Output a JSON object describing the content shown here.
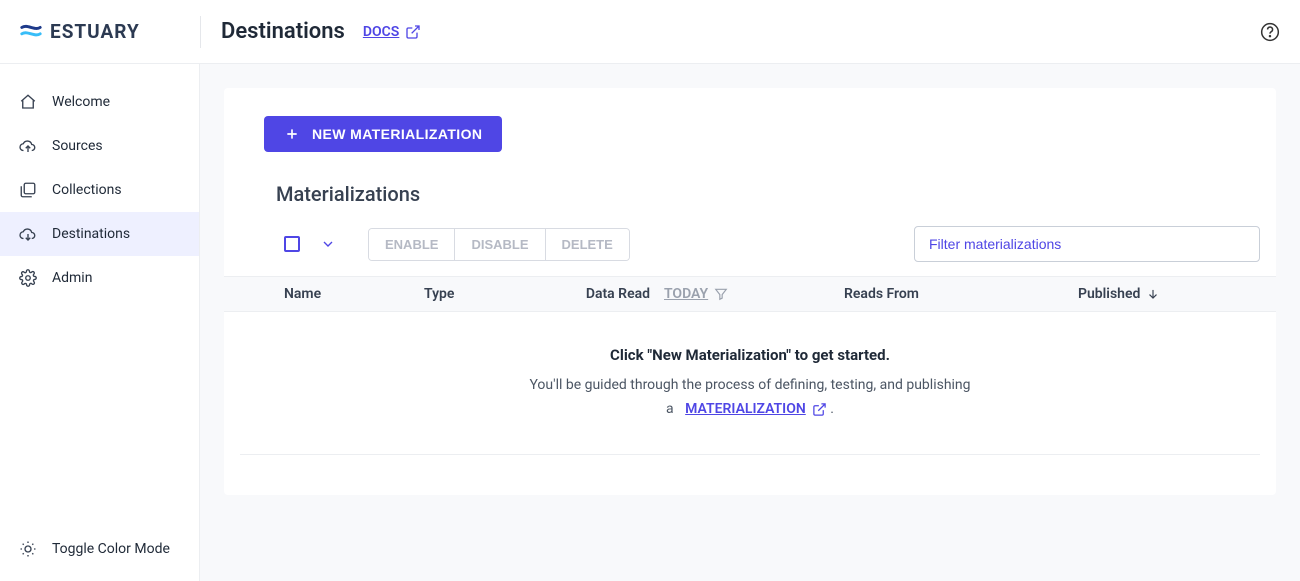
{
  "brand": {
    "name": "ESTUARY"
  },
  "header": {
    "title": "Destinations",
    "docs_label": "DOCS"
  },
  "sidebar": {
    "items": [
      {
        "label": "Welcome"
      },
      {
        "label": "Sources"
      },
      {
        "label": "Collections"
      },
      {
        "label": "Destinations"
      },
      {
        "label": "Admin"
      }
    ],
    "toggle_label": "Toggle Color Mode"
  },
  "main": {
    "new_button": "NEW MATERIALIZATION",
    "section_title": "Materializations",
    "actions": {
      "enable": "ENABLE",
      "disable": "DISABLE",
      "delete": "DELETE"
    },
    "filter_placeholder": "Filter materializations",
    "columns": {
      "name": "Name",
      "type": "Type",
      "data_read": "Data Read",
      "today": "TODAY",
      "reads_from": "Reads From",
      "published": "Published"
    },
    "empty": {
      "title": "Click \"New Materialization\" to get started.",
      "line": "You'll be guided through the process of defining, testing, and publishing",
      "prefix": "a",
      "link": "MATERIALIZATION",
      "suffix": "."
    }
  }
}
